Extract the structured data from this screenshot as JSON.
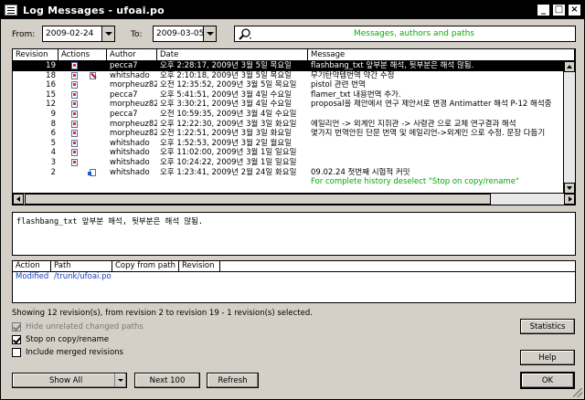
{
  "window": {
    "title": "Log Messages - ufoai.po"
  },
  "filters": {
    "from_label": "From:",
    "from_date": "2009-02-24",
    "to_label": "To:",
    "to_date": "2009-03-05",
    "search_placeholder": "Messages, authors and paths"
  },
  "log_table": {
    "columns": [
      "Revision",
      "Actions",
      "Author",
      "Date",
      "Message"
    ],
    "rows": [
      {
        "revision": "19",
        "actions": [
          "mod"
        ],
        "author": "pecca7",
        "date": "오후 2:28:17, 2009년 3월 5일 목요일",
        "message": "flashbang_txt 앞부분 해석, 뒷부분은 해석 않됨.",
        "selected": true
      },
      {
        "revision": "18",
        "actions": [
          "mod",
          "del"
        ],
        "author": "whitshado",
        "date": "오후 2:10:18, 2009년 3월 5일 목요일",
        "message": "무기탄약템번역 약간 수정"
      },
      {
        "revision": "16",
        "actions": [
          "mod"
        ],
        "author": "morpheuz82",
        "date": "오전 12:35:52, 2009년 3월 5일 목요일",
        "message": "pistol 관련 번역"
      },
      {
        "revision": "15",
        "actions": [
          "mod"
        ],
        "author": "pecca7",
        "date": "오후 5:41:51, 2009년 3월 4일 수요일",
        "message": "flamer_txt 내용번역 추가."
      },
      {
        "revision": "12",
        "actions": [
          "mod"
        ],
        "author": "morpheuz82",
        "date": "오후 3:30:21, 2009년 3월 4일 수요일",
        "message": "proposal을 제안에서 연구 제안서로 변경 Antimatter 해석 P-12 해석중"
      },
      {
        "revision": "9",
        "actions": [
          "mod"
        ],
        "author": "pecca7",
        "date": "오전 10:59:35, 2009년 3월 4일 수요일",
        "message": ""
      },
      {
        "revision": "8",
        "actions": [
          "mod"
        ],
        "author": "morpheuz82",
        "date": "오후 12:22:30, 2009년 3월 3일 화요일",
        "message": "에일리언 -> 외계인 지휘관 -> 사령관 으로 교체 연구결과 해석"
      },
      {
        "revision": "6",
        "actions": [
          "mod"
        ],
        "author": "morpheuz82",
        "date": "오전 1:22:51, 2009년 3월 3일 화요일",
        "message": "몇가지 번역안된 단문 번역 및 에일리언->외계인 으로 수정. 문장 다듬기"
      },
      {
        "revision": "5",
        "actions": [
          "mod"
        ],
        "author": "whitshado",
        "date": "오후 1:52:53, 2009년 3월 2일 월요일",
        "message": ""
      },
      {
        "revision": "4",
        "actions": [
          "mod"
        ],
        "author": "whitshado",
        "date": "오후 11:02:00, 2009년 3월 1일 일요일",
        "message": ""
      },
      {
        "revision": "3",
        "actions": [
          "mod"
        ],
        "author": "whitshado",
        "date": "오후 10:24:22, 2009년 3월 1일 일요일",
        "message": ""
      },
      {
        "revision": "2",
        "actions": [
          "add"
        ],
        "author": "whitshado",
        "date": "오후 1:23:41, 2009년 2월 24일 화요일",
        "message": "09.02.24 첫번째 시험적 커밋"
      },
      {
        "revision": "",
        "actions": [],
        "author": "",
        "date": "",
        "message": "For complete history deselect \"Stop on copy/rename\"",
        "hint": true
      }
    ]
  },
  "message_text": "flashbang_txt 앞부분 해석, 뒷부분은 해석 않됨.",
  "paths_table": {
    "columns": [
      "Action",
      "Path",
      "Copy from path",
      "Revision"
    ],
    "rows": [
      {
        "action": "Modified",
        "path": "/trunk/ufoai.po",
        "copy_from": "",
        "revision": ""
      }
    ]
  },
  "summary": "Showing 12 revision(s), from revision 2 to revision 19 - 1 revision(s) selected.",
  "options": {
    "hide_unrelated": "Hide unrelated changed paths",
    "stop_on_copy": "Stop on copy/rename",
    "include_merged": "Include merged revisions"
  },
  "buttons": {
    "statistics": "Statistics",
    "help": "Help",
    "show_all": "Show All",
    "next_100": "Next 100",
    "refresh": "Refresh",
    "ok": "OK"
  },
  "title_buttons": {
    "minimize": "_",
    "maximize": "□",
    "close": "×"
  }
}
